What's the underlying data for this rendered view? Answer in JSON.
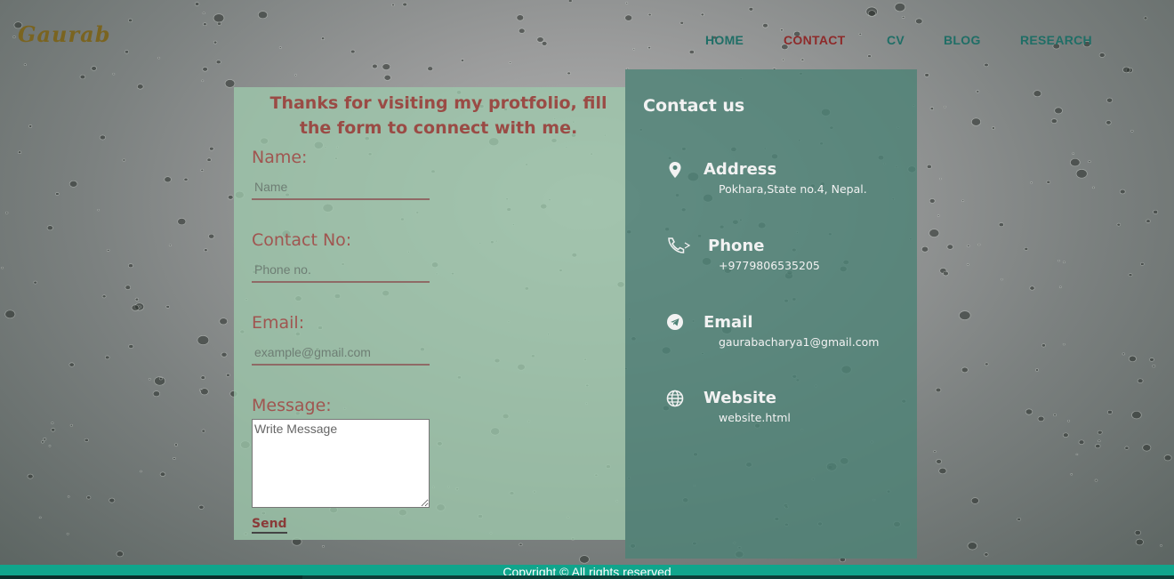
{
  "logo": "Gaurab",
  "nav": {
    "items": [
      {
        "label": "HOME"
      },
      {
        "label": "CONTACT",
        "active": true
      },
      {
        "label": "CV"
      },
      {
        "label": "BLOG"
      },
      {
        "label": "RESEARCH"
      }
    ]
  },
  "form": {
    "title": "Thanks for visiting my protfolio, fill the form to connect with me.",
    "name_label": "Name:",
    "name_placeholder": "Name",
    "contact_label": "Contact No:",
    "contact_placeholder": "Phone no.",
    "email_label": "Email:",
    "email_placeholder": "example@gmail.com",
    "message_label": "Message:",
    "message_placeholder": "Write Message",
    "send_label": "Send"
  },
  "contact": {
    "title": "Contact us",
    "items": [
      {
        "icon": "location-pin-icon",
        "heading": "Address",
        "value": "Pokhara,State no.4, Nepal."
      },
      {
        "icon": "phone-icon",
        "heading": "Phone",
        "value": "+9779806535205"
      },
      {
        "icon": "telegram-icon",
        "heading": "Email",
        "value": "gaurabacharya1@gmail.com"
      },
      {
        "icon": "globe-icon",
        "heading": "Website",
        "value": "website.html"
      }
    ]
  },
  "footer": {
    "text": "Copyright © All rights reserved"
  },
  "colors": {
    "nav_link": "#1f6e66",
    "nav_active": "#8e2a2a",
    "form_panel": "#9ec8ac",
    "contact_panel": "#4e8276",
    "footer": "#10a58c"
  }
}
